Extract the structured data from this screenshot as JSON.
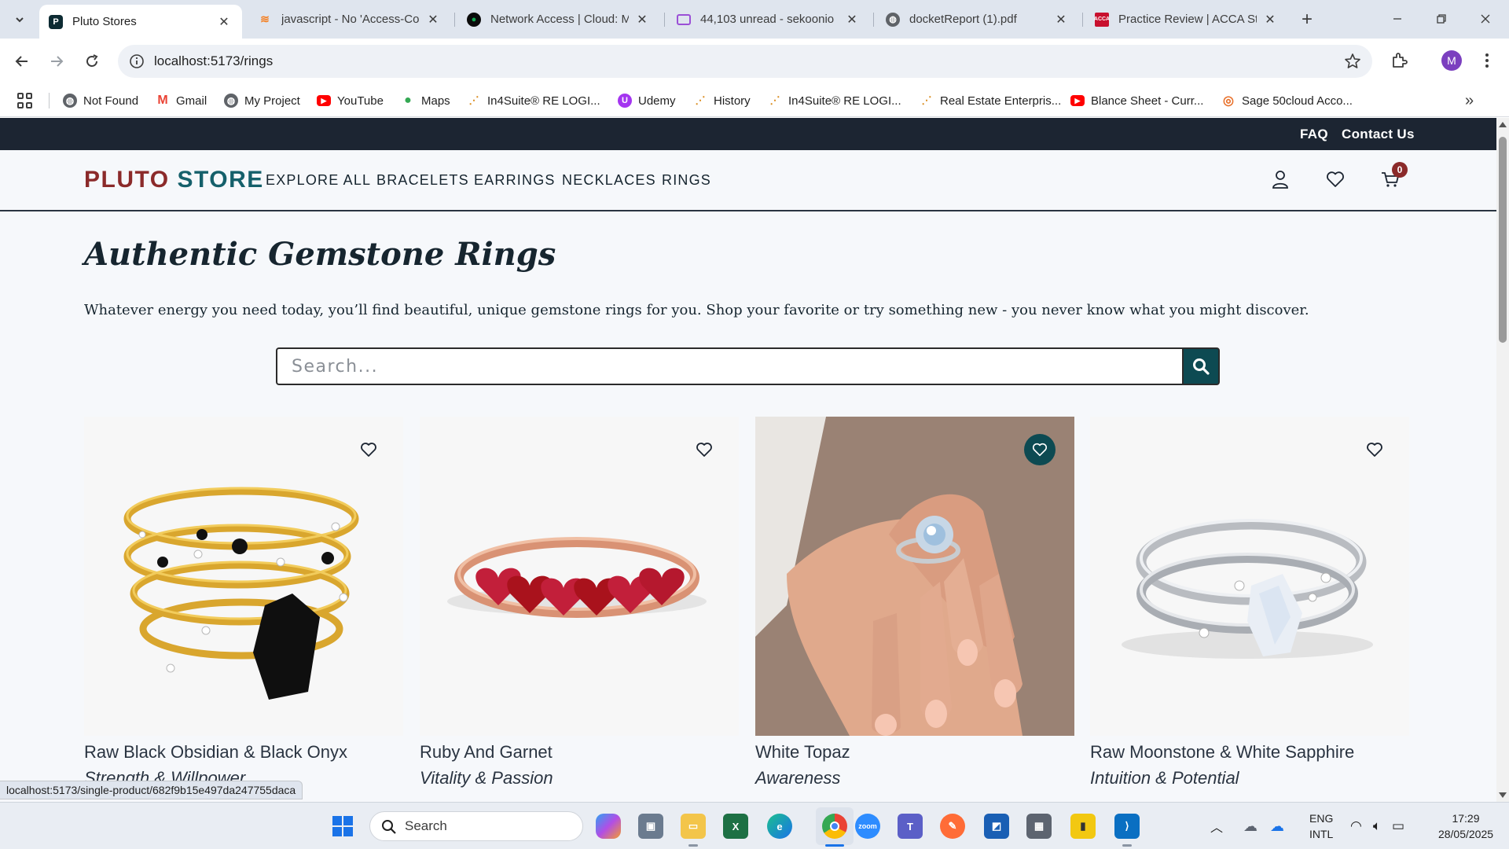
{
  "browser": {
    "tabs": [
      {
        "title": "Pluto Stores",
        "icon": "pluto-favicon",
        "active": true
      },
      {
        "title": "javascript - No 'Access-Co",
        "icon": "stackoverflow-favicon",
        "active": false
      },
      {
        "title": "Network Access | Cloud: M",
        "icon": "mongodb-favicon",
        "active": false
      },
      {
        "title": "44,103 unread - sekoonio",
        "icon": "mail-favicon",
        "active": false
      },
      {
        "title": "docketReport (1).pdf",
        "icon": "globe-favicon",
        "active": false
      },
      {
        "title": "Practice Review | ACCA Stu",
        "icon": "acca-favicon",
        "active": false
      }
    ],
    "url": "localhost:5173/rings",
    "profile_initial": "M",
    "bookmarks": [
      {
        "label": "Not Found",
        "icon": "globe-icon"
      },
      {
        "label": "Gmail",
        "icon": "gmail-icon"
      },
      {
        "label": "My Project",
        "icon": "globe-icon"
      },
      {
        "label": "YouTube",
        "icon": "youtube-icon"
      },
      {
        "label": "Maps",
        "icon": "maps-icon"
      },
      {
        "label": "In4Suite® RE LOGI...",
        "icon": "in4suite-icon"
      },
      {
        "label": "Udemy",
        "icon": "udemy-icon"
      },
      {
        "label": "History",
        "icon": "in4suite-icon"
      },
      {
        "label": "In4Suite® RE LOGI...",
        "icon": "in4suite-icon"
      },
      {
        "label": "Real Estate Enterpris...",
        "icon": "in4suite-icon"
      },
      {
        "label": "Blance Sheet - Curr...",
        "icon": "youtube-icon"
      },
      {
        "label": "Sage 50cloud Acco...",
        "icon": "sage-icon"
      }
    ],
    "status_url": "localhost:5173/single-product/682f9b15e497da247755daca"
  },
  "site": {
    "top_links": {
      "faq": "FAQ",
      "contact": "Contact Us"
    },
    "logo_part1": "PLUTO",
    "logo_part2": "STORE",
    "nav": [
      "EXPLORE ALL",
      "BRACELETS",
      "EARRINGS",
      "NECKLACES",
      "RINGS"
    ],
    "cart_count": "0",
    "title": "Authentic Gemstone Rings",
    "description": "Whatever energy you need today, you’ll find beautiful, unique gemstone rings for you. Shop your favorite or try something new - you never know what you might discover.",
    "search_placeholder": "Search...",
    "products": [
      {
        "name": "Raw Black Obsidian & Black Onyx",
        "tagline": "Strength & Willpower",
        "wishlisted": false
      },
      {
        "name": "Ruby And Garnet",
        "tagline": "Vitality & Passion",
        "wishlisted": false
      },
      {
        "name": "White Topaz",
        "tagline": "Awareness",
        "wishlisted": true
      },
      {
        "name": "Raw Moonstone & White Sapphire",
        "tagline": "Intuition & Potential",
        "wishlisted": false
      }
    ],
    "colors": {
      "accent_teal": "#0d4a52",
      "logo_red": "#8b2a2a",
      "logo_teal": "#15606b",
      "topbar": "#1c2532"
    }
  },
  "taskbar": {
    "search_label": "Search",
    "language": "ENG",
    "keyboard": "INTL",
    "time": "17:29",
    "date": "28/05/2025"
  }
}
